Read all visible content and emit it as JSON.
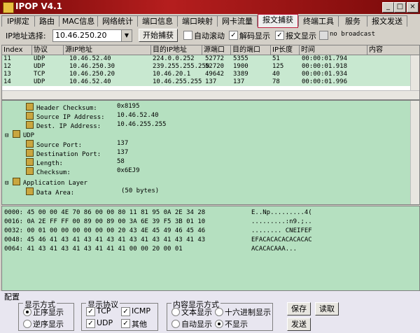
{
  "window": {
    "title": "IPOP V4.1",
    "min": "_",
    "max": "□",
    "close": "×"
  },
  "tabs": [
    {
      "label": "IP绑定"
    },
    {
      "label": "路由"
    },
    {
      "label": "MAC信息"
    },
    {
      "label": "网络统计"
    },
    {
      "label": "端口信息"
    },
    {
      "label": "端口映射"
    },
    {
      "label": "网卡流量"
    },
    {
      "label": "报文捕获"
    },
    {
      "label": "终端工具"
    },
    {
      "label": "服务"
    },
    {
      "label": "报文发送"
    }
  ],
  "toolbar": {
    "ip_label": "IP地址选择:",
    "ip_value": "10.46.250.20",
    "start_button": "开始捕获",
    "opt_autoscroll": "自动滚动",
    "opt_decode": "解码显示",
    "opt_packet": "报文显示",
    "opt_broadcast": "no broadcast"
  },
  "packet_table": {
    "headers": [
      "Index",
      "协议",
      "源IP地址",
      "目的IP地址",
      "源端口",
      "目的端口",
      "IP长度",
      "时间",
      "内容"
    ],
    "rows": [
      [
        "11",
        "UDP",
        "10.46.52.40",
        "224.0.0.252",
        "52772",
        "5355",
        "51",
        "00:00:01.794",
        ""
      ],
      [
        "12",
        "UDP",
        "10.46.250.30",
        "239.255.255.250",
        "52720",
        "1900",
        "125",
        "00:00:01.918",
        ""
      ],
      [
        "13",
        "TCP",
        "10.46.250.20",
        "10.46.20.1",
        "49642",
        "3389",
        "40",
        "00:00:01.934",
        ""
      ],
      [
        "14",
        "UDP",
        "10.46.52.40",
        "10.46.255.255",
        "137",
        "137",
        "78",
        "00:00:01.996",
        ""
      ]
    ]
  },
  "tree": {
    "ip_fields": [
      {
        "name": "Header Checksum:",
        "value": "0x8195"
      },
      {
        "name": "Source IP Address:",
        "value": "10.46.52.40"
      },
      {
        "name": "Dest.  IP Address:",
        "value": "10.46.255.255"
      }
    ],
    "udp_label": "UDP",
    "udp_fields": [
      {
        "name": "Source Port:",
        "value": "137"
      },
      {
        "name": "Destination Port:",
        "value": "137"
      },
      {
        "name": "Length:",
        "value": "58"
      },
      {
        "name": "Checksum:",
        "value": "0x6EJ9"
      }
    ],
    "app_label": "Application Layer",
    "app_fields": [
      {
        "name": "Data Area:",
        "value": "(50 bytes)"
      }
    ]
  },
  "hex_dump": [
    {
      "hex": "0000: 45 00 00 4E 70 86 00 00 80 11 81 95 0A 2E 34 28",
      "ascii": "E..Np.........4("
    },
    {
      "hex": "0016: 0A 2E FF FF 00 89 00 89 00 3A 6E 39 F5 3B 01 10",
      "ascii": ".........:n9.;.."
    },
    {
      "hex": "0032: 00 01 00 00 00 00 00 00 20 43 4E 45 49 46 45 46",
      "ascii": "........ CNEIFEF"
    },
    {
      "hex": "0048: 45 46 41 43 41 43 41 43 41 43 41 43 41 43 41 43",
      "ascii": "EFACACACACACACAC"
    },
    {
      "hex": "0064: 41 43 41 43 41 43 41 41 41 00 00 20 00 01",
      "ascii": "ACACACAAA..."
    }
  ],
  "config": {
    "title": "配置",
    "display_mode": {
      "title": "显示方式",
      "forward": "正序显示",
      "reverse": "逆序显示"
    },
    "protocol": {
      "title": "显示协议",
      "tcp": "TCP",
      "icmp": "ICMP",
      "udp": "UDP",
      "other": "其他"
    },
    "content": {
      "title": "内容显示方式",
      "text": "文本显示",
      "hex": "十六进制显示",
      "auto": "自动显示",
      "none": "不显示"
    },
    "save_button": "保存",
    "read_button": "读取",
    "send_button": "发送"
  }
}
